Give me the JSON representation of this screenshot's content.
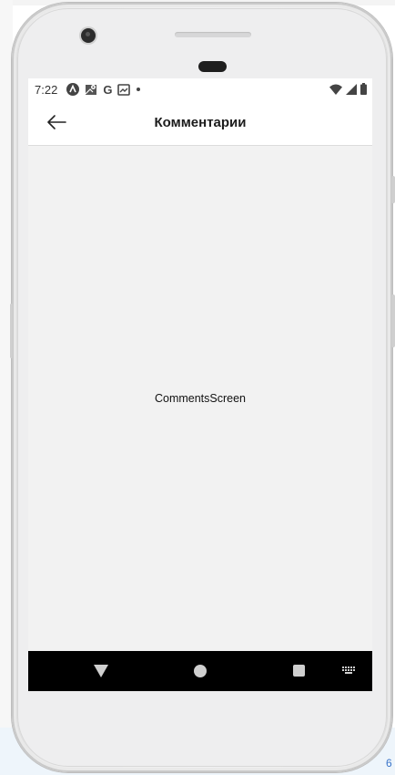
{
  "status_bar": {
    "time": "7:22",
    "left_icons": [
      "a-icon",
      "map-icon",
      "google-icon",
      "gallery-icon",
      "dot-icon"
    ],
    "google_letter": "G",
    "right_icons": [
      "wifi-icon",
      "signal-icon",
      "battery-icon"
    ]
  },
  "app_bar": {
    "title": "Комментарии",
    "back_icon": "arrow-left-icon"
  },
  "content": {
    "text": "CommentsScreen"
  },
  "nav_bar": {
    "buttons": [
      "back-triangle-icon",
      "home-circle-icon",
      "recent-square-icon",
      "keyboard-icon"
    ]
  },
  "colors": {
    "screen_bg": "#f2f2f2",
    "app_bar_bg": "#ffffff",
    "nav_bar_bg": "#000000",
    "link_blue": "#3a74c9"
  }
}
